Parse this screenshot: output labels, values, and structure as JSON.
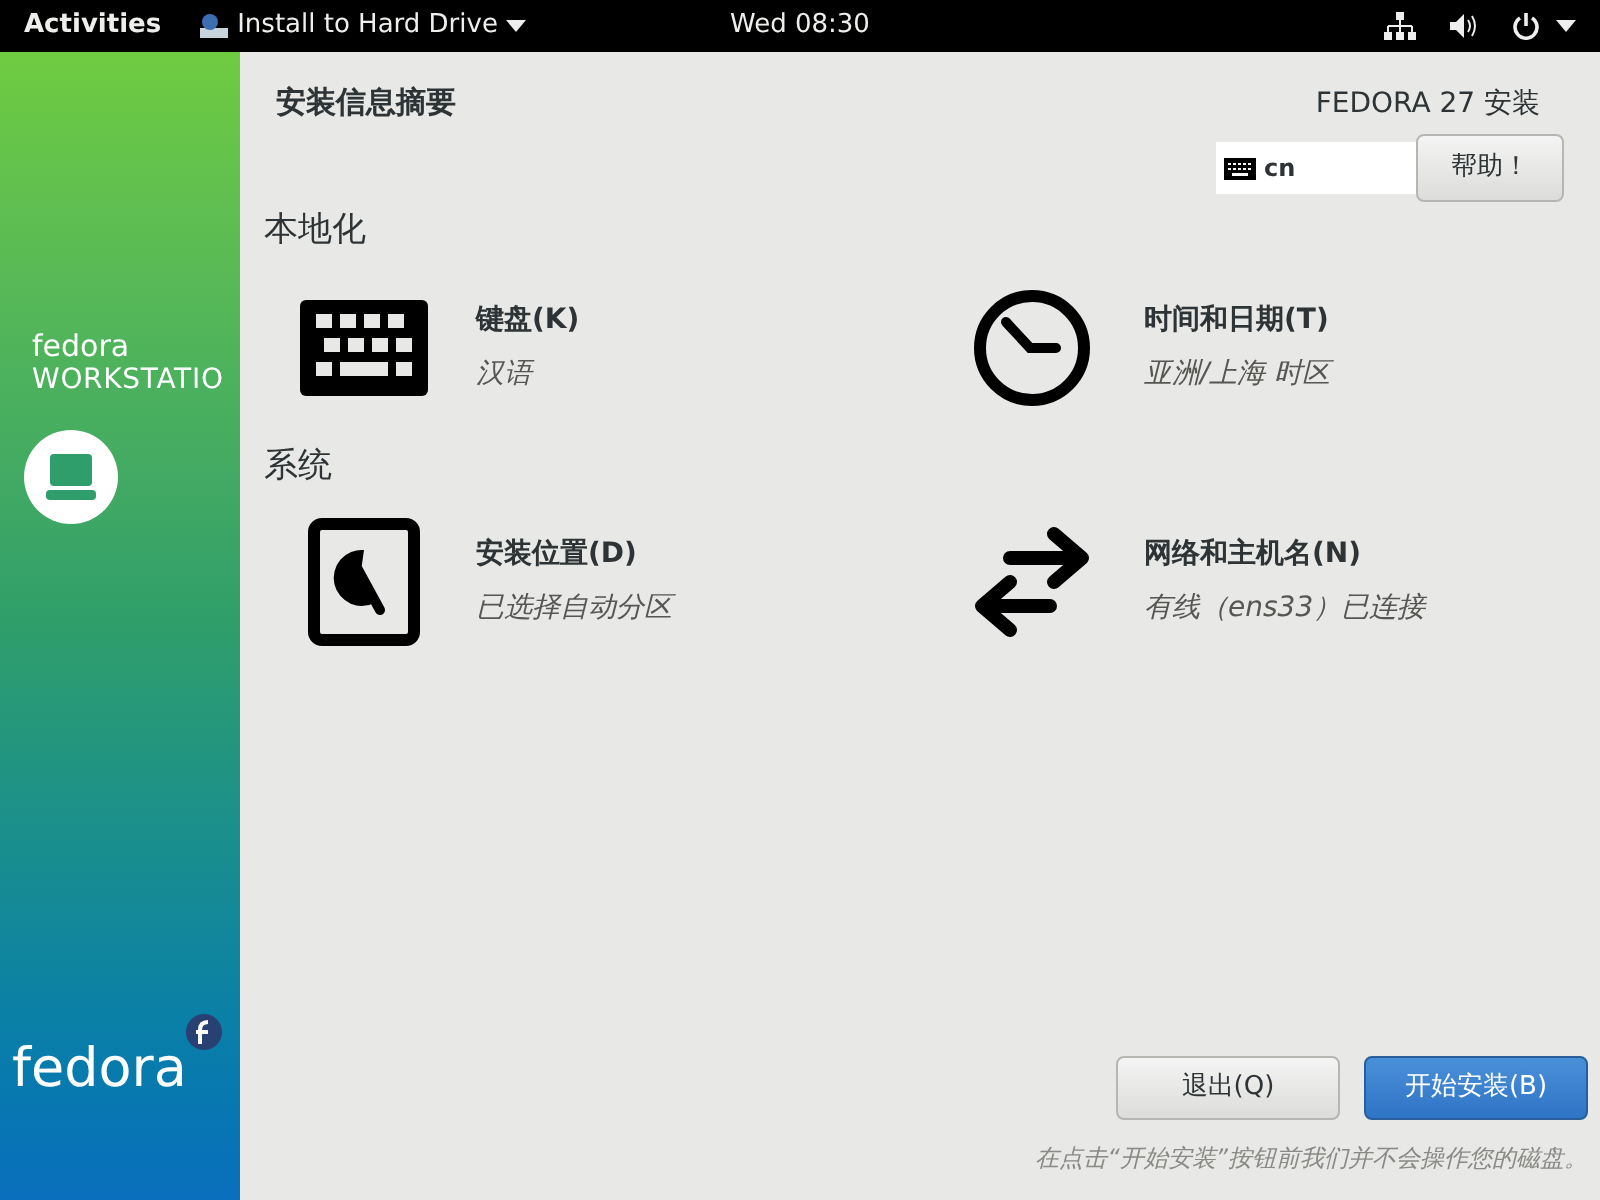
{
  "top_bar": {
    "activities": "Activities",
    "app_menu": "Install to Hard Drive",
    "clock": "Wed 08:30"
  },
  "sidebar": {
    "brand": "fedora",
    "edition": "WORKSTATIO",
    "footer_logo": "fedora"
  },
  "header": {
    "title": "安装信息摘要",
    "product": "FEDORA 27 安装",
    "keyboard_layout": "cn",
    "help_button": "帮助！"
  },
  "sections": [
    {
      "title": "本地化",
      "spokes": [
        {
          "kind": "keyboard",
          "name": "键盘(K)",
          "status": "汉语"
        },
        {
          "kind": "clock",
          "name": "时间和日期(T)",
          "status": "亚洲/上海 时区"
        }
      ]
    },
    {
      "title": "系统",
      "spokes": [
        {
          "kind": "disk",
          "name": "安装位置(D)",
          "status": "已选择自动分区"
        },
        {
          "kind": "network",
          "name": "网络和主机名(N)",
          "status": "有线（ens33）已连接"
        }
      ]
    }
  ],
  "footer": {
    "buttons": [
      {
        "label": "退出(Q)",
        "kind": "secondary"
      },
      {
        "label": "开始安装(B)",
        "kind": "primary"
      }
    ],
    "note": "在点击“开始安装”按钮前我们并不会操作您的磁盘。"
  }
}
